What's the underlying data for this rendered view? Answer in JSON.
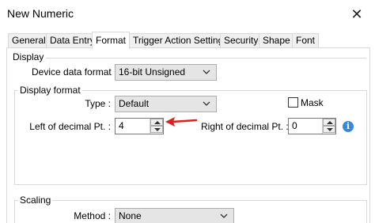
{
  "window": {
    "title": "New Numeric",
    "close_glyph": "✕"
  },
  "tabs": [
    {
      "label": "General",
      "active": false
    },
    {
      "label": "Data Entry",
      "active": false
    },
    {
      "label": "Format",
      "active": true
    },
    {
      "label": "Trigger Action Setting",
      "active": false
    },
    {
      "label": "Security",
      "active": false
    },
    {
      "label": "Shape",
      "active": false
    },
    {
      "label": "Font",
      "active": false
    }
  ],
  "display": {
    "section_label": "Display",
    "device_data_format_label": "Device data format :",
    "device_data_format_value": "16-bit Unsigned"
  },
  "display_format": {
    "group_label": "Display format",
    "type_label": "Type :",
    "type_value": "Default",
    "mask_label": "Mask",
    "mask_checked": false,
    "left_decimal_label": "Left of decimal Pt. :",
    "left_decimal_value": "4",
    "right_decimal_label": "Right of decimal Pt. :",
    "right_decimal_value": "0"
  },
  "scaling": {
    "group_label": "Scaling",
    "method_label": "Method :",
    "method_value": "None"
  },
  "annotation": {
    "arrow_color": "#e0201e",
    "icon": "red-arrow-icon"
  },
  "colors": {
    "info_icon": "#3a87e0",
    "combo_bg": "#e5e5e5",
    "border": "#d9d9d9"
  }
}
